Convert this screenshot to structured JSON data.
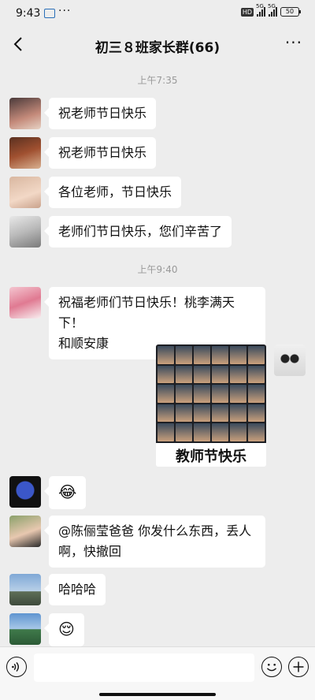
{
  "status_bar": {
    "time": "9:43",
    "dots": "···",
    "hd": "HD",
    "network1": "5G",
    "network2": "5G",
    "battery": "50"
  },
  "nav": {
    "title": "初三８班家长群(66)",
    "more": "···"
  },
  "time_dividers": [
    "上午7:35",
    "上午9:40"
  ],
  "messages": [
    {
      "text": "祝老师节日快乐"
    },
    {
      "text": "祝老师节日快乐"
    },
    {
      "text": "各位老师，节日快乐"
    },
    {
      "text": "老师们节日快乐，您们辛苦了"
    },
    {
      "line1": "祝福老师们节日快乐！桃李满天下！",
      "line2": "和顺安康"
    },
    {
      "image_caption": "教师节快乐"
    },
    {
      "emoji": "😂"
    },
    {
      "line1": "@陈俪莹爸爸 你发什么东西，丢人",
      "line2": "啊，快撤回"
    },
    {
      "text": "哈哈哈"
    },
    {
      "emoji": "😌"
    }
  ],
  "colors": {
    "background": "#ededed",
    "bubble": "#ffffff",
    "timestamp": "#999999"
  }
}
